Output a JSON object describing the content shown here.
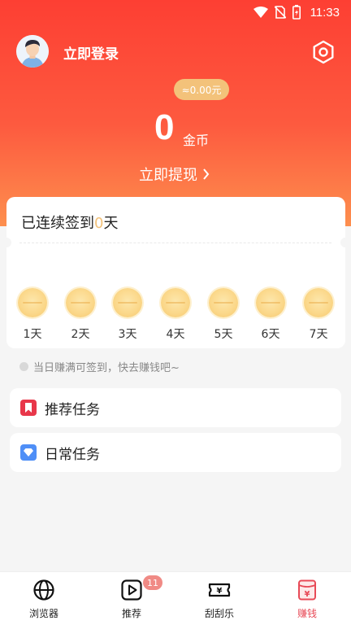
{
  "status_bar": {
    "time": "11:33"
  },
  "header": {
    "login_text": "立即登录",
    "approx_amount": "≈0.00元",
    "coin_count": "0",
    "coin_unit": "金币",
    "withdraw_label": "立即提现"
  },
  "checkin": {
    "title_prefix": "已连续签到",
    "streak": "0",
    "title_suffix": "天",
    "days": [
      "1天",
      "2天",
      "3天",
      "4天",
      "5天",
      "6天",
      "7天"
    ],
    "tip": "当日赚满可签到，快去赚钱吧~"
  },
  "tasks": {
    "recommend_label": "推荐任务",
    "daily_label": "日常任务"
  },
  "tabbar": {
    "items": [
      {
        "label": "浏览器",
        "icon": "globe-icon"
      },
      {
        "label": "推荐",
        "icon": "play-icon",
        "badge": "11"
      },
      {
        "label": "刮刮乐",
        "icon": "ticket-icon"
      },
      {
        "label": "赚钱",
        "icon": "wallet-icon"
      }
    ],
    "active_color": "#e84a57"
  },
  "colors": {
    "hero_top": "#fd3f33",
    "hero_bottom": "#fd8f4e",
    "gold": "#f3c27a",
    "recommend_icon": "#e8374a",
    "daily_icon": "#4f8ff7"
  }
}
